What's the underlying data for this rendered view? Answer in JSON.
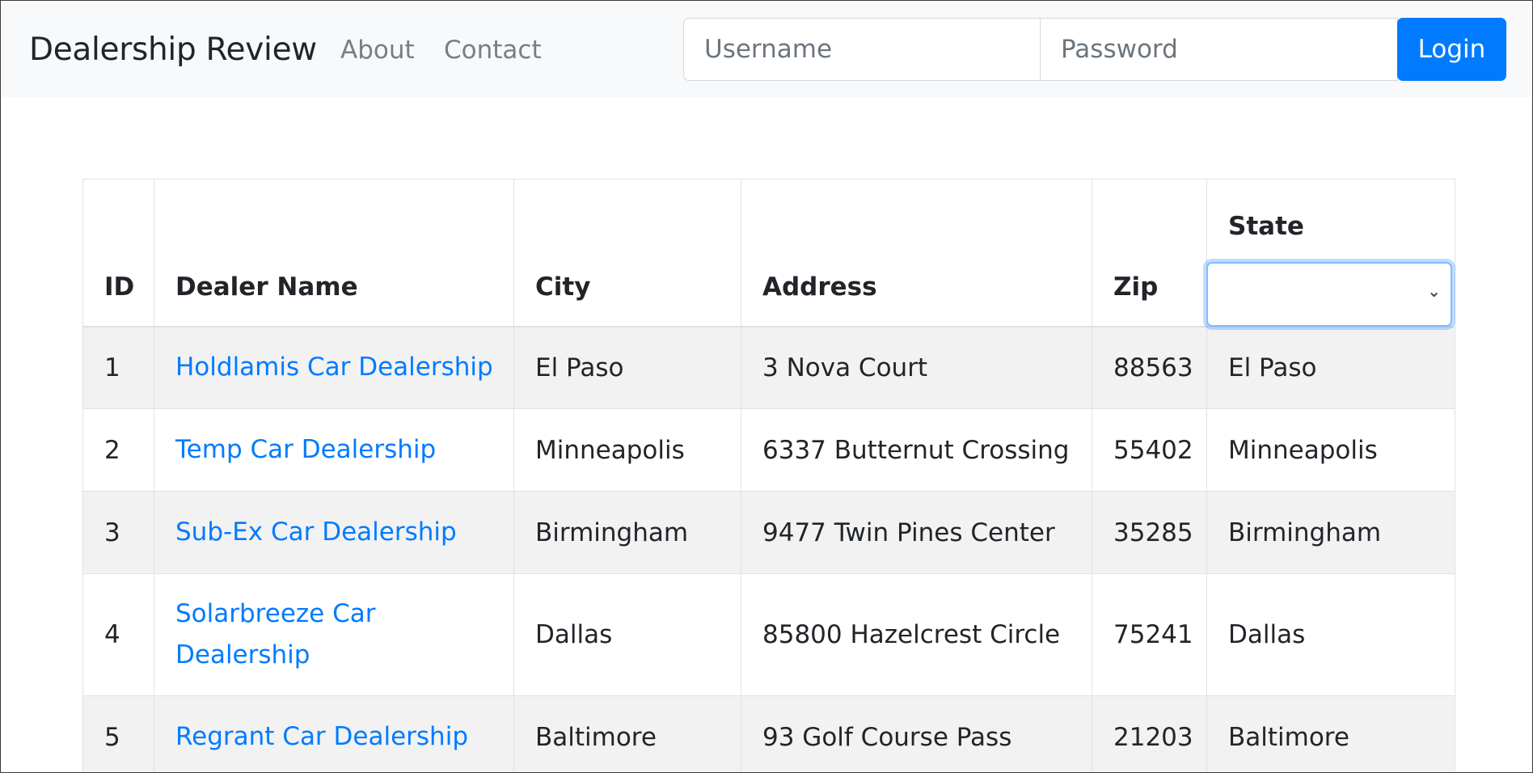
{
  "navbar": {
    "brand": "Dealership Review",
    "links": [
      "About",
      "Contact"
    ],
    "username_placeholder": "Username",
    "password_placeholder": "Password",
    "login_label": "Login"
  },
  "table": {
    "headers": {
      "id": "ID",
      "name": "Dealer Name",
      "city": "City",
      "address": "Address",
      "zip": "Zip",
      "state": "State"
    },
    "state_filter_value": "",
    "rows": [
      {
        "id": "1",
        "name": "Holdlamis Car Dealership",
        "city": "El Paso",
        "address": "3 Nova Court",
        "zip": "88563",
        "state": "El Paso"
      },
      {
        "id": "2",
        "name": "Temp Car Dealership",
        "city": "Minneapolis",
        "address": "6337 Butternut Crossing",
        "zip": "55402",
        "state": "Minneapolis"
      },
      {
        "id": "3",
        "name": "Sub-Ex Car Dealership",
        "city": "Birmingham",
        "address": "9477 Twin Pines Center",
        "zip": "35285",
        "state": "Birmingham"
      },
      {
        "id": "4",
        "name": "Solarbreeze Car Dealership",
        "city": "Dallas",
        "address": "85800 Hazelcrest Circle",
        "zip": "75241",
        "state": "Dallas"
      },
      {
        "id": "5",
        "name": "Regrant Car Dealership",
        "city": "Baltimore",
        "address": "93 Golf Course Pass",
        "zip": "21203",
        "state": "Baltimore"
      }
    ]
  },
  "colors": {
    "link": "#007bff",
    "primary": "#007bff",
    "navbar_bg": "#f8f9fa",
    "stripe": "#f2f2f2"
  }
}
